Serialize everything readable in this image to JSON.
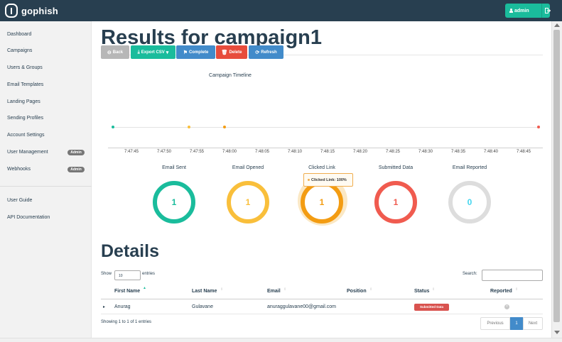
{
  "app": {
    "logo_text": "gophish"
  },
  "header": {
    "user_label": "admin"
  },
  "sidebar": {
    "items": [
      {
        "label": "Dashboard"
      },
      {
        "label": "Campaigns"
      },
      {
        "label": "Users & Groups"
      },
      {
        "label": "Email Templates"
      },
      {
        "label": "Landing Pages"
      },
      {
        "label": "Sending Profiles"
      },
      {
        "label": "Account Settings"
      },
      {
        "label": "User Management",
        "badge": "Admin"
      },
      {
        "label": "Webhooks",
        "badge": "Admin"
      }
    ],
    "secondary": [
      {
        "label": "User Guide"
      },
      {
        "label": "API Documentation"
      }
    ]
  },
  "main": {
    "title": "Results for campaign1",
    "buttons": {
      "back": "Back",
      "export": "Export CSV",
      "complete": "Complete",
      "delete": "Delete",
      "refresh": "Refresh"
    },
    "timeline": {
      "title": "Campaign Timeline",
      "ticks": [
        "7:47:45",
        "7:47:50",
        "7:47:55",
        "7:48:00",
        "7:48:05",
        "7:48:10",
        "7:48:15",
        "7:48:20",
        "7:48:25",
        "7:48:30",
        "7:48:35",
        "7:48:40",
        "7:48:45"
      ]
    },
    "stats": [
      {
        "label": "Email Sent",
        "value": "1",
        "color": "#1abc9c"
      },
      {
        "label": "Email Opened",
        "value": "1",
        "color": "#f9bf3b"
      },
      {
        "label": "Clicked Link",
        "value": "1",
        "color": "#f39c12"
      },
      {
        "label": "Submitted Data",
        "value": "1",
        "color": "#f05b4f"
      },
      {
        "label": "Email Reported",
        "value": "0",
        "color": "#45d6ef"
      }
    ],
    "tooltip": "Clicked Link: 100%"
  },
  "details": {
    "title": "Details",
    "show_label": "Show",
    "entries_value": "10",
    "entries_label": "entries",
    "search_label": "Search:",
    "columns": [
      "First Name",
      "Last Name",
      "Email",
      "Position",
      "Status",
      "Reported"
    ],
    "rows": [
      {
        "first_name": "Anurag",
        "last_name": "Gulavane",
        "email": "anuraggulavane00@gmail.com",
        "position": "",
        "status": "Submitted Data"
      }
    ],
    "info": "Showing 1 to 1 of 1 entries",
    "pagination": {
      "previous": "Previous",
      "current": "1",
      "next": "Next"
    }
  },
  "colors": {
    "navbar": "#283f50",
    "primary": "#1abc9c",
    "back": "#b7b7b7",
    "export": "#1abc9c",
    "complete": "#428bca",
    "delete": "#e74c3c",
    "refresh": "#428bca",
    "status_submitted": "#d9534f"
  }
}
